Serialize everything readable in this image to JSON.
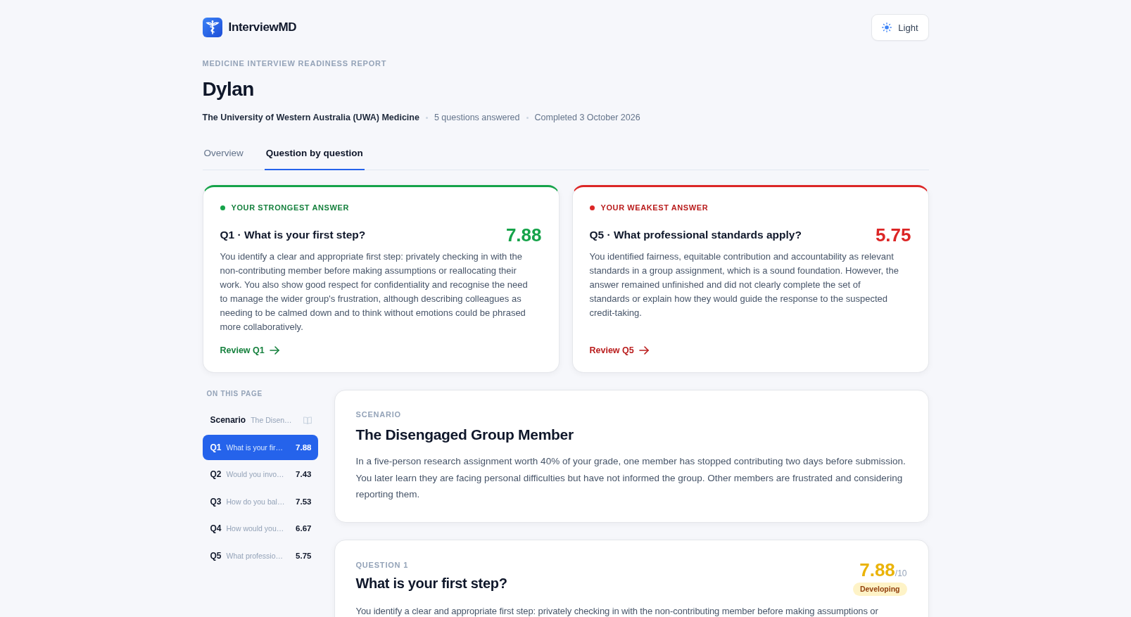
{
  "header": {
    "brand": "InterviewMD",
    "theme_button": "Light"
  },
  "report": {
    "eyebrow": "MEDICINE INTERVIEW READINESS REPORT",
    "name": "Dylan",
    "meta": [
      "The University of Western Australia (UWA) Medicine",
      "5 questions answered",
      "Completed 3 October 2026"
    ]
  },
  "tabs": [
    {
      "label": "Overview",
      "selected": false
    },
    {
      "label": "Question by question",
      "selected": true
    }
  ],
  "highlights": [
    {
      "kind": "strongest",
      "label": "YOUR STRONGEST ANSWER",
      "title": "Q1 · What is your first step?",
      "score": "7.88",
      "summary": "You identify a clear and appropriate first step: privately checking in with the non-contributing member before making assumptions or reallocating their work. You also show good respect for confidentiality and recognise the need to manage the wider group's frustration, although describing colleagues as needing to be calmed down and to think without emotions could be phrased more collaboratively.",
      "link": "Review Q1"
    },
    {
      "kind": "weakest",
      "label": "YOUR WEAKEST ANSWER",
      "title": "Q5 · What professional standards apply?",
      "score": "5.75",
      "summary": "You identified fairness, equitable contribution and accountability as relevant standards in a group assignment, which is a sound foundation. However, the answer remained unfinished and did not clearly complete the set of standards or explain how they would guide the response to the suspected credit-taking.",
      "link": "Review Q5"
    }
  ],
  "sidebar": {
    "title": "ON THIS PAGE",
    "items": [
      {
        "kind": "scenario",
        "label": "Scenario",
        "text": "The Disen…",
        "selected": false
      },
      {
        "kind": "question",
        "label": "Q1",
        "text": "What is your fir…",
        "score": "7.88",
        "selected": true
      },
      {
        "kind": "question",
        "label": "Q2",
        "text": "Would you invo…",
        "score": "7.43",
        "selected": false
      },
      {
        "kind": "question",
        "label": "Q3",
        "text": "How do you bal…",
        "score": "7.53",
        "selected": false
      },
      {
        "kind": "question",
        "label": "Q4",
        "text": "How would you…",
        "score": "6.67",
        "selected": false
      },
      {
        "kind": "question",
        "label": "Q5",
        "text": "What professio…",
        "score": "5.75",
        "selected": false
      }
    ]
  },
  "scenario": {
    "label": "SCENARIO",
    "title": "The Disengaged Group Member",
    "body": "In a five-person research assignment worth 40% of your grade, one member has stopped contributing two days before submission. You later learn they are facing personal difficulties but have not informed the group. Other members are frustrated and considering reporting them."
  },
  "question": {
    "label": "QUESTION 1",
    "title": "What is your first step?",
    "score": "7.88",
    "score_max": "/10",
    "rating": "Developing",
    "body": "You identify a clear and appropriate first step: privately checking in with the non-contributing member before making assumptions or"
  }
}
